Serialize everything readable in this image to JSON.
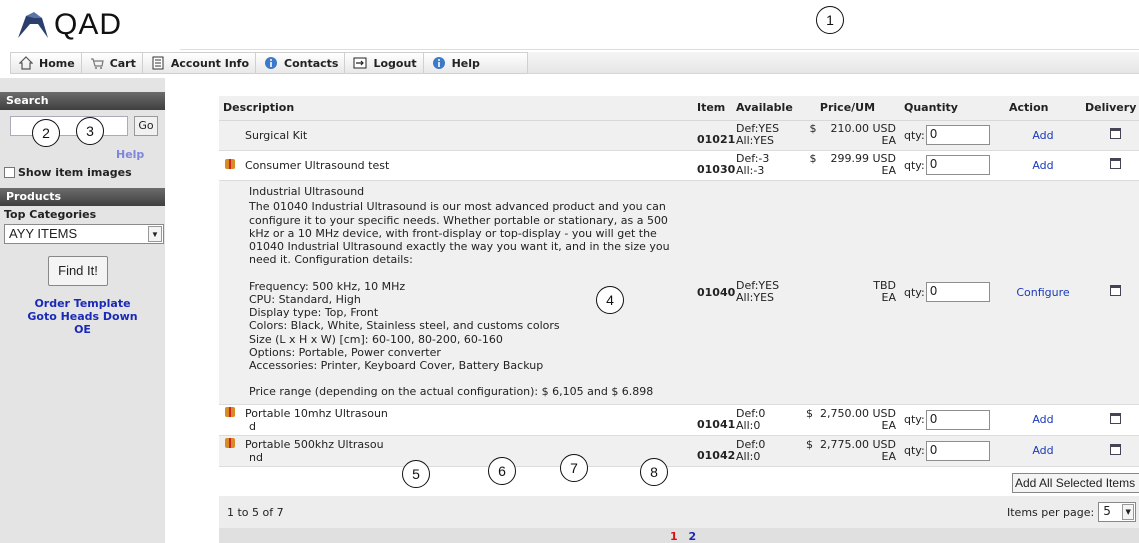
{
  "brand": {
    "logo_text": "QAD"
  },
  "markers": [
    "1",
    "2",
    "3",
    "4",
    "5",
    "6",
    "7",
    "8"
  ],
  "nav": {
    "items": [
      {
        "label": "Home",
        "icon": "home-icon"
      },
      {
        "label": "Cart",
        "icon": "cart-icon"
      },
      {
        "label": "Account Info",
        "icon": "account-icon"
      },
      {
        "label": "Contacts",
        "icon": "contacts-icon"
      },
      {
        "label": "Logout",
        "icon": "logout-icon"
      },
      {
        "label": "Help",
        "icon": "help-icon"
      }
    ]
  },
  "sidebar": {
    "search_header": "Search",
    "go_label": "Go",
    "help_label": "Help",
    "show_images_label": "Show item images",
    "products_header": "Products",
    "top_categories_label": "Top Categories",
    "category_selected": "AYY ITEMS",
    "find_label": "Find It!",
    "links": [
      "Order Template",
      "Goto Heads Down",
      "OE"
    ]
  },
  "table": {
    "headers": {
      "description": "Description",
      "item": "Item",
      "available": "Available",
      "price": "Price/UM",
      "quantity": "Quantity",
      "action": "Action",
      "delivery": "Delivery"
    },
    "qty_prefix": "qty:",
    "rows": [
      {
        "desc_line1": "Surgical Kit",
        "desc_line2": "",
        "item": "01021",
        "avail1": "Def:YES",
        "avail2": "All:YES",
        "price": "$    210.00 USD",
        "um": "EA",
        "qty": "0",
        "action": "Add",
        "gift": false
      },
      {
        "desc_line1": "Consumer Ultrasound test",
        "desc_line2": "",
        "item": "01030",
        "avail1": "Def:-3",
        "avail2": "All:-3",
        "price": "$    299.99 USD",
        "um": "EA",
        "qty": "0",
        "action": "Add",
        "gift": true
      },
      {
        "desc_line1": "Industrial Ultrasound",
        "desc_line2": "The 01040 Industrial Ultrasound is our most advanced product and you can configure it to your specific needs. Whether portable or stationary, as a 500 kHz or a 10 MHz device, with front-display or top-display - you will get the 01040 Industrial Ultrasound exactly the way you want it, and in the size you need it. Configuration details:\n\nFrequency: 500 kHz, 10 MHz\nCPU: Standard, High\nDisplay type: Top, Front\nColors: Black, White, Stainless steel, and customs colors\nSize (L x H x W) [cm]: 60-100, 80-200, 60-160\nOptions: Portable, Power converter\nAccessories: Printer, Keyboard Cover, Battery Backup\n\nPrice range (depending on the actual configuration): $ 6,105 and $ 6.898",
        "item": "01040",
        "avail1": "Def:YES",
        "avail2": "All:YES",
        "price": "TBD",
        "um": "EA",
        "qty": "0",
        "action": "Configure",
        "gift": false
      },
      {
        "desc_line1": "Portable 10mhz Ultrasoun",
        "desc_line2": "d",
        "item": "01041",
        "avail1": "Def:0",
        "avail2": "All:0",
        "price": "$  2,750.00 USD",
        "um": "EA",
        "qty": "0",
        "action": "Add",
        "gift": true
      },
      {
        "desc_line1": "Portable 500khz Ultrasou",
        "desc_line2": "nd",
        "item": "01042",
        "avail1": "Def:0",
        "avail2": "All:0",
        "price": "$  2,775.00 USD",
        "um": "EA",
        "qty": "0",
        "action": "Add",
        "gift": true
      }
    ]
  },
  "add_all_label": "Add All Selected Items",
  "paging": {
    "range_text": "1 to 5 of 7",
    "items_per_page_label": "Items per page:",
    "items_per_page_value": "5",
    "current_page": "1",
    "other_page": "2"
  }
}
